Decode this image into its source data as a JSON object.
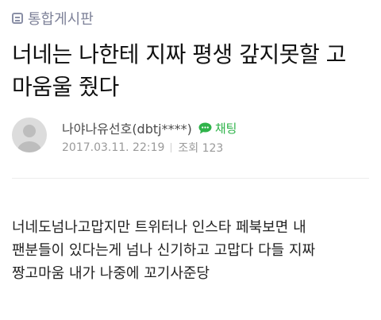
{
  "board": {
    "label": "통합게시판",
    "icon": "list-icon"
  },
  "post": {
    "title_lines": [
      "너네는 나한테 지짜 평생 갚지못할 고",
      "마움울 줬다"
    ],
    "author": "나야나유선호(dbtj****)",
    "chat_label": "채팅",
    "date": "2017.03.11. 22:19",
    "views": "조회 123",
    "body_lines": [
      "너네도넘나고맙지만 트위터나 인스타 페북보면 내",
      "팬분들이 있다는게 넘나 신기하고 고맙다 다들 지짜",
      "짱고마움 내가 나중에 꼬기사준당"
    ]
  },
  "colors": {
    "chat_green": "#2fb34a",
    "board_gray": "#7d8198",
    "meta_gray": "#9a9a9a"
  }
}
